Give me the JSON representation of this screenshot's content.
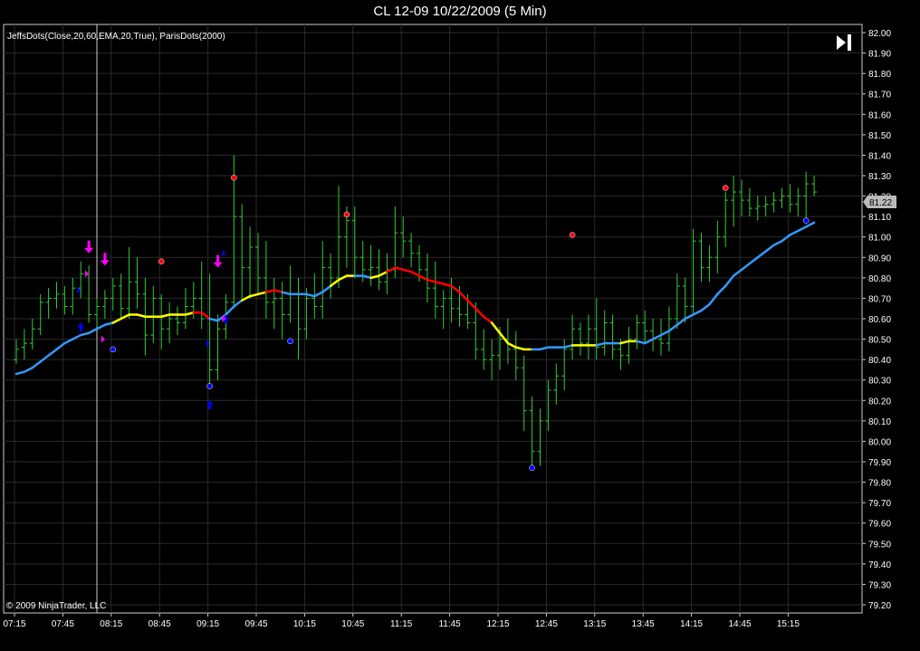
{
  "chart_title": "CL 12-09  10/22/2009 (5 Min)",
  "indicator_label": "JeffsDots(Close,20,60,EMA,20,True), ParisDots(2000)",
  "copyright": "© 2009 NinjaTrader, LLC",
  "last_price_label": "81.22",
  "colors": {
    "background": "#000000",
    "bars": "#33cc33",
    "grid": "#2a2a2a",
    "ema_up": "#3399ff",
    "ema_flat": "#ffff00",
    "ema_down": "#ff0000",
    "dot_high": "#ff0000",
    "dot_low": "#0000ff",
    "arrow_magenta": "#ff00ff",
    "arrow_blue": "#0000ff"
  },
  "icons": {
    "scroll_end": "skip-to-end-icon"
  },
  "chart_data": {
    "type": "ohlc",
    "x_tick_labels": [
      "07:15",
      "07:45",
      "08:15",
      "08:45",
      "09:15",
      "09:45",
      "10:15",
      "10:45",
      "11:15",
      "11:45",
      "12:15",
      "12:45",
      "13:15",
      "13:45",
      "14:15",
      "14:45",
      "15:15"
    ],
    "y_tick_labels": [
      "82.00",
      "81.90",
      "81.80",
      "81.70",
      "81.60",
      "81.50",
      "81.40",
      "81.30",
      "81.20",
      "81.10",
      "81.00",
      "80.90",
      "80.80",
      "80.70",
      "80.60",
      "80.50",
      "80.40",
      "80.30",
      "80.20",
      "80.10",
      "80.00",
      "79.90",
      "79.80",
      "79.70",
      "79.60",
      "79.50",
      "79.40",
      "79.30",
      "79.20"
    ],
    "ylim": [
      79.16,
      82.04
    ],
    "grid": true,
    "bars": [
      [
        80.4,
        80.5,
        80.38,
        80.45
      ],
      [
        80.46,
        80.55,
        80.4,
        80.48
      ],
      [
        80.48,
        80.6,
        80.45,
        80.55
      ],
      [
        80.55,
        80.72,
        80.52,
        80.68
      ],
      [
        80.68,
        80.75,
        80.6,
        80.7
      ],
      [
        80.7,
        80.78,
        80.65,
        80.72
      ],
      [
        80.72,
        80.76,
        80.62,
        80.66
      ],
      [
        80.66,
        80.8,
        80.62,
        80.75
      ],
      [
        80.75,
        80.88,
        80.7,
        80.82
      ],
      [
        80.82,
        80.86,
        80.58,
        80.62
      ],
      [
        80.62,
        80.7,
        80.56,
        80.66
      ],
      [
        80.66,
        80.74,
        80.6,
        80.7
      ],
      [
        80.7,
        80.8,
        80.64,
        80.76
      ],
      [
        80.76,
        80.82,
        80.6,
        80.65
      ],
      [
        80.65,
        80.95,
        80.6,
        80.78
      ],
      [
        80.78,
        80.9,
        80.65,
        80.72
      ],
      [
        80.72,
        80.8,
        80.42,
        80.52
      ],
      [
        80.52,
        80.76,
        80.48,
        80.7
      ],
      [
        80.7,
        80.72,
        80.45,
        80.55
      ],
      [
        80.55,
        80.68,
        80.48,
        80.6
      ],
      [
        80.6,
        80.66,
        80.52,
        80.58
      ],
      [
        80.58,
        80.75,
        80.55,
        80.66
      ],
      [
        80.66,
        80.78,
        80.6,
        80.7
      ],
      [
        80.7,
        80.88,
        80.55,
        80.6
      ],
      [
        80.6,
        80.82,
        80.28,
        80.35
      ],
      [
        80.35,
        80.62,
        80.3,
        80.55
      ],
      [
        80.55,
        80.72,
        80.5,
        80.68
      ],
      [
        80.68,
        81.4,
        80.65,
        81.1
      ],
      [
        81.1,
        81.16,
        80.7,
        80.85
      ],
      [
        80.85,
        81.05,
        80.7,
        80.95
      ],
      [
        80.95,
        81.02,
        80.72,
        80.8
      ],
      [
        80.8,
        80.98,
        80.6,
        80.68
      ],
      [
        80.68,
        80.8,
        80.55,
        80.7
      ],
      [
        80.7,
        80.78,
        80.5,
        80.62
      ],
      [
        80.62,
        80.86,
        80.58,
        80.72
      ],
      [
        80.72,
        80.8,
        80.4,
        80.55
      ],
      [
        80.55,
        80.75,
        80.5,
        80.7
      ],
      [
        80.7,
        80.82,
        80.6,
        80.66
      ],
      [
        80.66,
        80.98,
        80.6,
        80.85
      ],
      [
        80.85,
        80.92,
        80.7,
        80.8
      ],
      [
        80.8,
        81.25,
        80.75,
        81.0
      ],
      [
        81.0,
        81.15,
        80.85,
        81.08
      ],
      [
        81.08,
        81.15,
        80.8,
        80.9
      ],
      [
        80.9,
        80.98,
        80.78,
        80.84
      ],
      [
        80.84,
        80.96,
        80.76,
        80.85
      ],
      [
        80.85,
        80.94,
        80.74,
        80.78
      ],
      [
        80.78,
        80.92,
        80.72,
        80.84
      ],
      [
        80.84,
        81.15,
        80.8,
        81.02
      ],
      [
        81.02,
        81.1,
        80.9,
        80.98
      ],
      [
        80.98,
        81.02,
        80.85,
        80.92
      ],
      [
        80.92,
        80.96,
        80.78,
        80.84
      ],
      [
        80.84,
        80.92,
        80.68,
        80.75
      ],
      [
        80.75,
        80.88,
        80.6,
        80.66
      ],
      [
        80.66,
        80.74,
        80.55,
        80.7
      ],
      [
        80.7,
        80.8,
        80.58,
        80.65
      ],
      [
        80.65,
        80.76,
        80.56,
        80.62
      ],
      [
        80.62,
        80.72,
        80.55,
        80.58
      ],
      [
        80.58,
        80.68,
        80.4,
        80.45
      ],
      [
        80.45,
        80.55,
        80.35,
        80.4
      ],
      [
        80.4,
        80.5,
        80.3,
        80.42
      ],
      [
        80.42,
        80.56,
        80.35,
        80.5
      ],
      [
        80.5,
        80.6,
        80.38,
        80.45
      ],
      [
        80.45,
        80.54,
        80.3,
        80.36
      ],
      [
        80.36,
        80.42,
        80.05,
        80.15
      ],
      [
        80.15,
        80.22,
        79.87,
        79.95
      ],
      [
        79.95,
        80.16,
        79.88,
        80.1
      ],
      [
        80.1,
        80.3,
        80.05,
        80.25
      ],
      [
        80.25,
        80.38,
        80.18,
        80.32
      ],
      [
        80.32,
        80.5,
        80.25,
        80.45
      ],
      [
        80.45,
        80.62,
        80.4,
        80.55
      ],
      [
        80.55,
        80.58,
        80.42,
        80.48
      ],
      [
        80.48,
        80.62,
        80.4,
        80.55
      ],
      [
        80.55,
        80.7,
        80.4,
        80.46
      ],
      [
        80.46,
        80.64,
        80.42,
        80.58
      ],
      [
        80.58,
        80.62,
        80.4,
        80.45
      ],
      [
        80.45,
        80.5,
        80.35,
        80.42
      ],
      [
        80.42,
        80.56,
        80.38,
        80.5
      ],
      [
        80.5,
        80.62,
        80.45,
        80.58
      ],
      [
        80.58,
        80.64,
        80.48,
        80.54
      ],
      [
        80.54,
        80.6,
        80.44,
        80.5
      ],
      [
        80.5,
        80.6,
        80.42,
        80.48
      ],
      [
        80.48,
        80.66,
        80.44,
        80.6
      ],
      [
        80.6,
        80.82,
        80.55,
        80.76
      ],
      [
        80.76,
        80.8,
        80.58,
        80.66
      ],
      [
        80.66,
        81.04,
        80.62,
        80.98
      ],
      [
        80.98,
        81.02,
        80.78,
        80.85
      ],
      [
        80.85,
        80.96,
        80.78,
        80.9
      ],
      [
        80.9,
        81.08,
        80.82,
        81.0
      ],
      [
        81.0,
        81.22,
        80.95,
        81.18
      ],
      [
        81.18,
        81.3,
        81.05,
        81.22
      ],
      [
        81.22,
        81.28,
        81.1,
        81.18
      ],
      [
        81.18,
        81.24,
        81.1,
        81.14
      ],
      [
        81.14,
        81.2,
        81.08,
        81.15
      ],
      [
        81.15,
        81.2,
        81.1,
        81.16
      ],
      [
        81.16,
        81.22,
        81.12,
        81.18
      ],
      [
        81.18,
        81.24,
        81.14,
        81.2
      ],
      [
        81.2,
        81.26,
        81.12,
        81.16
      ],
      [
        81.16,
        81.24,
        81.1,
        81.2
      ],
      [
        81.2,
        81.32,
        81.08,
        81.26
      ],
      [
        81.26,
        81.3,
        81.2,
        81.22
      ]
    ],
    "ema": [
      80.33,
      80.34,
      80.36,
      80.39,
      80.42,
      80.45,
      80.48,
      80.5,
      80.52,
      80.53,
      80.55,
      80.57,
      80.58,
      80.6,
      80.62,
      80.62,
      80.61,
      80.61,
      80.61,
      80.62,
      80.62,
      80.62,
      80.63,
      80.63,
      80.6,
      80.59,
      80.62,
      80.66,
      80.69,
      80.71,
      80.72,
      80.73,
      80.74,
      80.73,
      80.72,
      80.72,
      80.72,
      80.71,
      80.73,
      80.76,
      80.79,
      80.81,
      80.81,
      80.81,
      80.8,
      80.81,
      80.83,
      80.85,
      80.84,
      80.83,
      80.81,
      80.79,
      80.78,
      80.77,
      80.76,
      80.73,
      80.69,
      80.65,
      80.61,
      80.58,
      80.53,
      80.48,
      80.46,
      80.45,
      80.45,
      80.45,
      80.46,
      80.46,
      80.46,
      80.47,
      80.47,
      80.47,
      80.47,
      80.48,
      80.48,
      80.48,
      80.49,
      80.49,
      80.48,
      80.5,
      80.52,
      80.54,
      80.57,
      80.6,
      80.62,
      80.64,
      80.67,
      80.72,
      80.76,
      80.81,
      80.84,
      80.87,
      80.9,
      80.93,
      80.96,
      80.98,
      81.01,
      81.03,
      81.05,
      81.07
    ],
    "ema_colors": [
      "up",
      "up",
      "up",
      "up",
      "up",
      "up",
      "up",
      "up",
      "up",
      "up",
      "up",
      "up",
      "up",
      "flat",
      "flat",
      "flat",
      "flat",
      "flat",
      "flat",
      "flat",
      "flat",
      "flat",
      "flat",
      "down",
      "down",
      "up",
      "up",
      "up",
      "up",
      "flat",
      "flat",
      "flat",
      "down",
      "down",
      "up",
      "up",
      "up",
      "up",
      "up",
      "up",
      "flat",
      "flat",
      "flat",
      "up",
      "up",
      "flat",
      "flat",
      "down",
      "down",
      "down",
      "down",
      "down",
      "down",
      "down",
      "down",
      "down",
      "down",
      "down",
      "down",
      "down",
      "flat",
      "flat",
      "flat",
      "flat",
      "flat",
      "up",
      "up",
      "up",
      "up",
      "up",
      "flat",
      "flat",
      "flat",
      "up",
      "up",
      "up",
      "flat",
      "flat",
      "up",
      "up",
      "up",
      "up",
      "up",
      "up",
      "up",
      "up",
      "up",
      "up",
      "up",
      "up",
      "up",
      "up",
      "up",
      "up",
      "up",
      "up",
      "up",
      "up",
      "up",
      "up"
    ],
    "high_dots": [
      [
        18,
        80.88
      ],
      [
        27,
        81.29
      ],
      [
        41,
        81.11
      ],
      [
        69,
        81.01
      ],
      [
        88,
        81.24
      ]
    ],
    "low_dots": [
      [
        12,
        80.45
      ],
      [
        24,
        80.27
      ],
      [
        34,
        80.49
      ],
      [
        64,
        79.87
      ],
      [
        98,
        81.08
      ]
    ],
    "down_arrows": [
      [
        9,
        80.92
      ],
      [
        11,
        80.86
      ],
      [
        25,
        80.85
      ]
    ],
    "up_arrows_blue": [
      [
        8,
        80.58
      ],
      [
        24,
        80.2
      ],
      [
        26,
        80.62
      ]
    ],
    "tri_magenta": [
      [
        9,
        80.82
      ],
      [
        11,
        80.5
      ],
      [
        26,
        80.6
      ]
    ],
    "tri_blue": [
      [
        8,
        80.74
      ],
      [
        24,
        80.48
      ],
      [
        26,
        80.92
      ]
    ]
  }
}
